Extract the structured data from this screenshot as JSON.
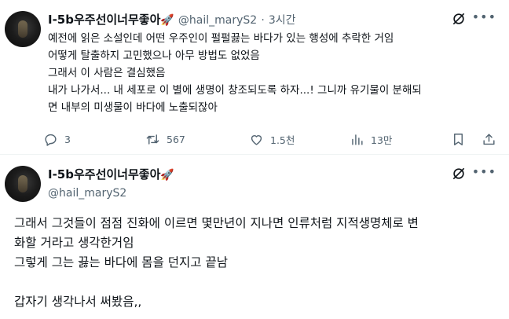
{
  "tweet1": {
    "display_name": "I-5b우주선이너무좋아",
    "emoji": "🚀",
    "handle": "@hail_maryS2",
    "separator": "·",
    "time": "3시간",
    "lines": [
      "예전에 읽은 소설인데 어떤 우주인이 펄펄끓는 바다가 있는 행성에 추락한 거임",
      "어떻게 탈출하지 고민했으나 아무 방법도 없었음",
      "그래서 이 사람은 결심했음",
      "내가 나가서... 내 세포로 이 별에 생명이 창조되도록 하자...! 그니까 유기물이 분해되",
      "면 내부의 미생물이 바다에 노출되잖아"
    ],
    "actions": {
      "reply_count": "3",
      "retweet_count": "567",
      "like_count": "1.5천",
      "views_count": "13만"
    }
  },
  "tweet2": {
    "display_name": "I-5b우주선이너무좋아",
    "emoji": "🚀",
    "handle": "@hail_maryS2",
    "lines": [
      "그래서 그것들이 점점 진화에 이르면 몇만년이 지나면 인류처럼 지적생명체로 변",
      "화할 거라고 생각한거임",
      "그렇게 그는 끓는 바다에 몸을 던지고 끝남",
      "",
      "갑자기 생각나서 써봤음,,"
    ]
  },
  "icons": {
    "more": "more-horizontal-icon",
    "mute": "mute-icon",
    "reply": "reply-icon",
    "retweet": "retweet-icon",
    "like": "heart-icon",
    "views": "views-icon",
    "bookmark": "bookmark-icon",
    "share": "share-icon"
  },
  "colors": {
    "text": "#0f1419",
    "secondary": "#536471",
    "divider": "#eff3f4"
  }
}
